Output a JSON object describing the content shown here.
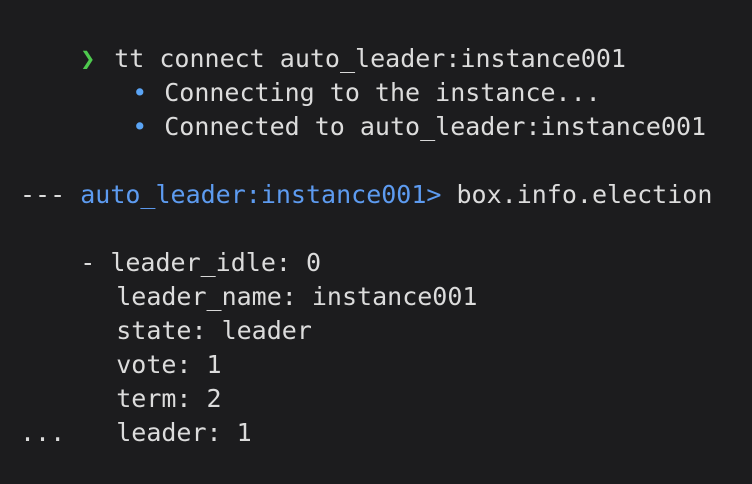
{
  "terminal": {
    "prompt_symbol": "❯",
    "command": "tt connect auto_leader:instance001",
    "messages": [
      "Connecting to the instance...",
      "Connected to auto_leader:instance001"
    ],
    "bullet_symbol": "•",
    "console_prompt": "auto_leader:instance001>",
    "console_command": " box.info.election",
    "yaml_start": "---",
    "yaml_first_prefix": "- ",
    "yaml_lines": [
      "leader_idle: 0",
      "leader_name: instance001",
      "state: leader",
      "vote: 1",
      "term: 2",
      "leader: 1"
    ],
    "yaml_end": "..."
  },
  "colors": {
    "background": "#1c1c1e",
    "text": "#dcdcdc",
    "prompt_arrow": "#4ec94e",
    "bullet": "#5aa4f5",
    "console_prompt": "#5d9bf0"
  }
}
